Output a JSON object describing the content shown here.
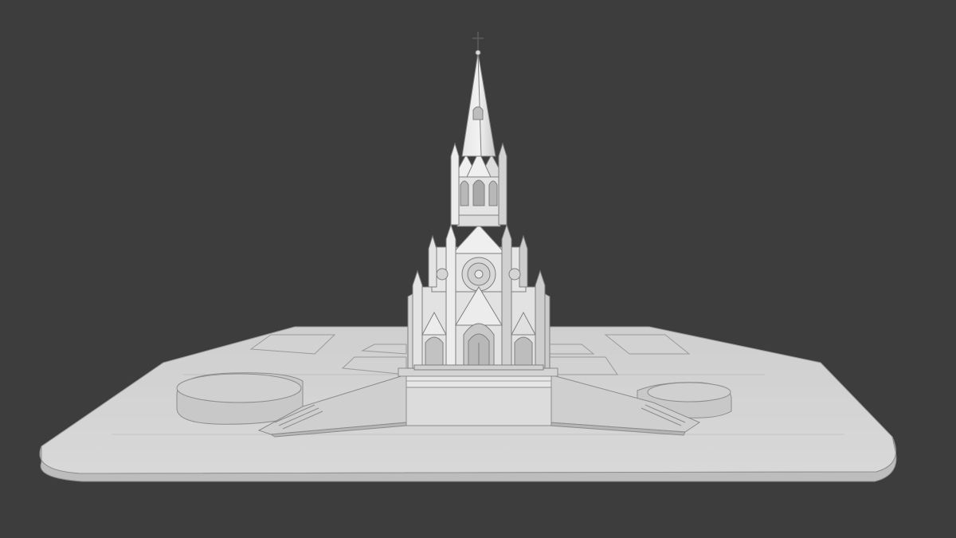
{
  "scene": {
    "background_color": "#3d3d3d",
    "model_color": "#d9d9d9",
    "edge_color": "#8a8a8a",
    "subject": "church-model"
  }
}
